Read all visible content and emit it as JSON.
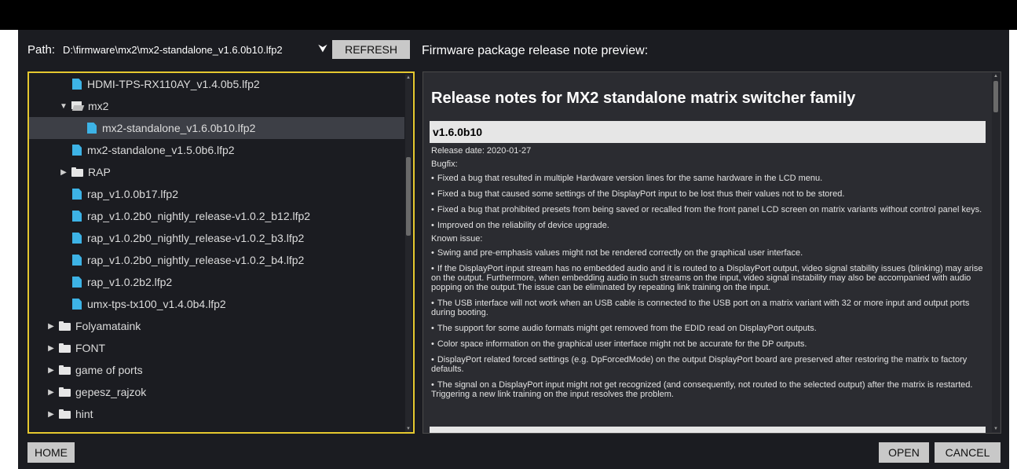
{
  "path": {
    "label": "Path:",
    "value": "D:\\firmware\\mx2\\mx2-standalone_v1.6.0b10.lfp2",
    "refresh_label": "REFRESH"
  },
  "preview_label": "Firmware package release note preview:",
  "tree": {
    "items": [
      {
        "label": "HDMI-TPS-RX110AY_v1.4.0b5.lfp2",
        "type": "file",
        "indent": 2
      },
      {
        "label": "mx2",
        "type": "folder-open",
        "indent": 1,
        "caret": "▼"
      },
      {
        "label": "mx2-standalone_v1.6.0b10.lfp2",
        "type": "file",
        "indent": 2,
        "selected": true
      },
      {
        "label": "mx2-standalone_v1.5.0b6.lfp2",
        "type": "file",
        "indent": 1.5
      },
      {
        "label": "RAP",
        "type": "folder",
        "indent": 1,
        "caret": "▶"
      },
      {
        "label": "rap_v1.0.0b17.lfp2",
        "type": "file",
        "indent": 1.5
      },
      {
        "label": "rap_v1.0.2b0_nightly_release-v1.0.2_b12.lfp2",
        "type": "file",
        "indent": 1.5
      },
      {
        "label": "rap_v1.0.2b0_nightly_release-v1.0.2_b3.lfp2",
        "type": "file",
        "indent": 1.5
      },
      {
        "label": "rap_v1.0.2b0_nightly_release-v1.0.2_b4.lfp2",
        "type": "file",
        "indent": 1.5
      },
      {
        "label": "rap_v1.0.2b2.lfp2",
        "type": "file",
        "indent": 1.5
      },
      {
        "label": "umx-tps-tx100_v1.4.0b4.lfp2",
        "type": "file",
        "indent": 1.5
      },
      {
        "label": "Folyamataink",
        "type": "folder",
        "indent": 0,
        "caret": "▶"
      },
      {
        "label": "FONT",
        "type": "folder",
        "indent": 0,
        "caret": "▶"
      },
      {
        "label": "game of ports",
        "type": "folder",
        "indent": 0,
        "caret": "▶"
      },
      {
        "label": "gepesz_rajzok",
        "type": "folder",
        "indent": 0,
        "caret": "▶"
      },
      {
        "label": "hint",
        "type": "folder",
        "indent": 0,
        "caret": "▶"
      }
    ]
  },
  "notes": {
    "title": "Release notes for MX2 standalone matrix switcher family",
    "version": "v1.6.0b10",
    "release_date": "Release date: 2020-01-27",
    "bugfix_heading": "Bugfix:",
    "bugfixes": [
      "Fixed a bug that resulted in multiple Hardware version lines for the same hardware in the LCD menu.",
      "Fixed a bug that caused some settings of the DisplayPort input to be lost thus their values not to be stored.",
      "Fixed a bug that prohibited presets from being saved or recalled from the front panel LCD screen on matrix variants without control panel keys.",
      "Improved on the reliability of device upgrade."
    ],
    "known_heading": "Known issue:",
    "known_issues": [
      "Swing and pre-emphasis values might not be rendered correctly on the graphical user interface.",
      "If the DisplayPort input stream has no embedded audio and it is routed to a DisplayPort output, video signal stability issues (blinking) may arise on the output. Furthermore, when embedding audio in such streams on the input, video signal instability may also be accompanied with audio popping on the output.The issue can be eliminated by repeating link training on the input.",
      "The USB interface will not work when an USB cable is connected to the USB port on a matrix variant with 32 or more input and output ports during booting.",
      "The support for some audio formats might get removed from the EDID read on DisplayPort outputs.",
      "Color space information on the graphical user interface might not be accurate for the DP outputs.",
      "DisplayPort related forced settings (e.g. DpForcedMode) on the output DisplayPort board are preserved after restoring the matrix to factory defaults.",
      "The signal on a DisplayPort input might not get recognized (and consequently, not routed to the selected output) after the matrix is restarted. Triggering a new link training on the input resolves the problem."
    ]
  },
  "buttons": {
    "home": "HOME",
    "open": "OPEN",
    "cancel": "CANCEL"
  },
  "colors": {
    "accent_border": "#e5c82f",
    "file_icon": "#3db3e6",
    "background": "#1b1c21"
  }
}
